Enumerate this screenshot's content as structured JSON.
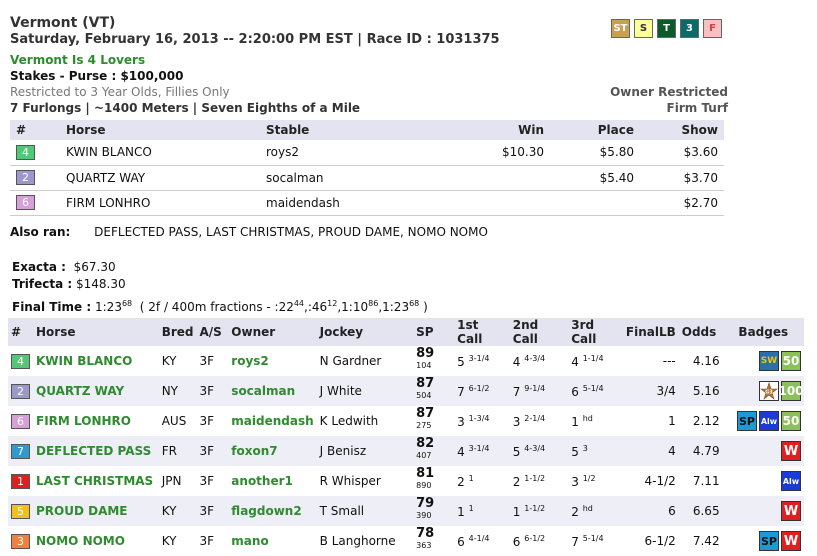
{
  "header": {
    "track": "Vermont (VT)",
    "date_line": "Saturday, February 16, 2013 -- 2:20:00 PM EST | Race ID : 1031375",
    "race_title": "Vermont Is 4 Lovers",
    "purse": "Stakes - Purse : $100,000",
    "restriction": "Restricted to 3 Year Olds, Fillies Only",
    "distance": "7 Furlongs | ~1400 Meters | Seven Eighths of a Mile",
    "owner_restricted": "Owner Restricted",
    "surface": "Firm Turf"
  },
  "top_badges": [
    {
      "label": "ST",
      "bg": "#c8a050",
      "fg": "#ffffff"
    },
    {
      "label": "S",
      "bg": "#ffff99",
      "fg": "#333333"
    },
    {
      "label": "T",
      "bg": "#0a5a2a",
      "fg": "#ffffff"
    },
    {
      "label": "3",
      "bg": "#0a6a6a",
      "fg": "#ffffff"
    },
    {
      "label": "F",
      "bg": "#f8c0c0",
      "fg": "#cc4444"
    }
  ],
  "results": {
    "headers": [
      "#",
      "Horse",
      "Stable",
      "Win",
      "Place",
      "Show"
    ],
    "rows": [
      {
        "pp": "4",
        "pp_bg": "#50c878",
        "pp_fg": "#ffffff",
        "horse": "KWIN BLANCO",
        "stable": "roys2",
        "win": "$10.30",
        "place": "$5.80",
        "show": "$3.60"
      },
      {
        "pp": "2",
        "pp_bg": "#9999cc",
        "pp_fg": "#ffffff",
        "horse": "QUARTZ WAY",
        "stable": "socalman",
        "win": "",
        "place": "$5.40",
        "show": "$3.70"
      },
      {
        "pp": "6",
        "pp_bg": "#d8a0d8",
        "pp_fg": "#ffffff",
        "horse": "FIRM LONHRO",
        "stable": "maidendash",
        "win": "",
        "place": "",
        "show": "$2.70"
      }
    ]
  },
  "also_ran": {
    "label": "Also ran:",
    "value": "DEFLECTED PASS, LAST CHRISTMAS, PROUD DAME, NOMO NOMO"
  },
  "exotics": {
    "exacta_label": "Exacta :",
    "exacta_value": "$67.30",
    "trifecta_label": "Trifecta :",
    "trifecta_value": "$148.30"
  },
  "final_time": {
    "label": "Final Time :",
    "time": "1:23",
    "time_sup": "68",
    "fractions_prefix": "( 2f / 400m fractions - :22",
    "f1_sup": "44",
    "f2": ",:46",
    "f2_sup": "12",
    "f3": ",1:10",
    "f3_sup": "86",
    "f4": ",1:23",
    "f4_sup": "68",
    "close": " )"
  },
  "main": {
    "headers": [
      "#",
      "Horse",
      "Bred",
      "A/S",
      "Owner",
      "Jockey",
      "SP",
      "1st Call",
      "2nd Call",
      "3rd Call",
      "FinalLB",
      "Odds",
      "Badges"
    ],
    "rows": [
      {
        "pp": "4",
        "pp_bg": "#50c878",
        "pp_fg": "#ffffff",
        "horse": "KWIN BLANCO",
        "bred": "KY",
        "as": "3F",
        "owner": "roys2",
        "jockey": "N Gardner",
        "sp": "89",
        "sp_sup": "104",
        "c1": "5",
        "c1_sup": "3-1/4",
        "c2": "4",
        "c2_sup": "4-3/4",
        "c3": "4",
        "c3_sup": "1-1/4",
        "final_lb": "---",
        "odds": "4.16",
        "badges": [
          "sw-icon",
          "50-icon"
        ]
      },
      {
        "pp": "2",
        "pp_bg": "#9999cc",
        "pp_fg": "#ffffff",
        "horse": "QUARTZ WAY",
        "bred": "NY",
        "as": "3F",
        "owner": "socalman",
        "jockey": "J White",
        "sp": "87",
        "sp_sup": "504",
        "c1": "7",
        "c1_sup": "6-1/2",
        "c2": "7",
        "c2_sup": "9-1/4",
        "c3": "6",
        "c3_sup": "5-1/4",
        "final_lb": "3/4",
        "odds": "5.16",
        "badges": [
          "g3-icon",
          "100-icon"
        ]
      },
      {
        "pp": "6",
        "pp_bg": "#d8a0d8",
        "pp_fg": "#ffffff",
        "horse": "FIRM LONHRO",
        "bred": "AUS",
        "as": "3F",
        "owner": "maidendash",
        "jockey": "K Ledwith",
        "sp": "87",
        "sp_sup": "275",
        "c1": "3",
        "c1_sup": "1-3/4",
        "c2": "3",
        "c2_sup": "2-1/4",
        "c3": "1",
        "c3_sup": "hd",
        "final_lb": "1",
        "odds": "2.12",
        "badges": [
          "sp-icon",
          "alw-icon",
          "50-icon"
        ]
      },
      {
        "pp": "7",
        "pp_bg": "#3399cc",
        "pp_fg": "#ffffff",
        "horse": "DEFLECTED PASS",
        "bred": "FR",
        "as": "3F",
        "owner": "foxon7",
        "jockey": "J Benisz",
        "sp": "82",
        "sp_sup": "407",
        "c1": "4",
        "c1_sup": "3-1/4",
        "c2": "5",
        "c2_sup": "4-3/4",
        "c3": "5",
        "c3_sup": "3",
        "final_lb": "4",
        "odds": "4.79",
        "badges": [
          "w-icon"
        ]
      },
      {
        "pp": "1",
        "pp_bg": "#e02020",
        "pp_fg": "#ffffff",
        "horse": "LAST CHRISTMAS",
        "bred": "JPN",
        "as": "3F",
        "owner": "another1",
        "jockey": "R Whisper",
        "sp": "81",
        "sp_sup": "890",
        "c1": "2",
        "c1_sup": "1",
        "c2": "2",
        "c2_sup": "1-1/2",
        "c3": "3",
        "c3_sup": "1/2",
        "final_lb": "4-1/2",
        "odds": "7.11",
        "badges": [
          "alw-icon"
        ]
      },
      {
        "pp": "5",
        "pp_bg": "#f0c020",
        "pp_fg": "#ffffff",
        "horse": "PROUD DAME",
        "bred": "KY",
        "as": "3F",
        "owner": "flagdown2",
        "jockey": "T Small",
        "sp": "79",
        "sp_sup": "390",
        "c1": "1",
        "c1_sup": "1",
        "c2": "1",
        "c2_sup": "1-1/2",
        "c3": "2",
        "c3_sup": "hd",
        "final_lb": "6",
        "odds": "6.65",
        "badges": [
          "w-icon"
        ]
      },
      {
        "pp": "3",
        "pp_bg": "#f08040",
        "pp_fg": "#ffffff",
        "horse": "NOMO NOMO",
        "bred": "KY",
        "as": "3F",
        "owner": "mano",
        "jockey": "B Langhorne",
        "sp": "78",
        "sp_sup": "363",
        "c1": "6",
        "c1_sup": "4-1/4",
        "c2": "6",
        "c2_sup": "6-1/2",
        "c3": "7",
        "c3_sup": "5-1/4",
        "final_lb": "6-1/2",
        "odds": "7.42",
        "badges": [
          "sp-icon",
          "w-icon"
        ]
      }
    ]
  },
  "badge_text": {
    "sw-icon": "SW",
    "g3-icon": "G3",
    "sp-icon": "SP",
    "alw-icon": "Alw",
    "50-icon": "50",
    "100-icon": "100",
    "w-icon": "W"
  }
}
